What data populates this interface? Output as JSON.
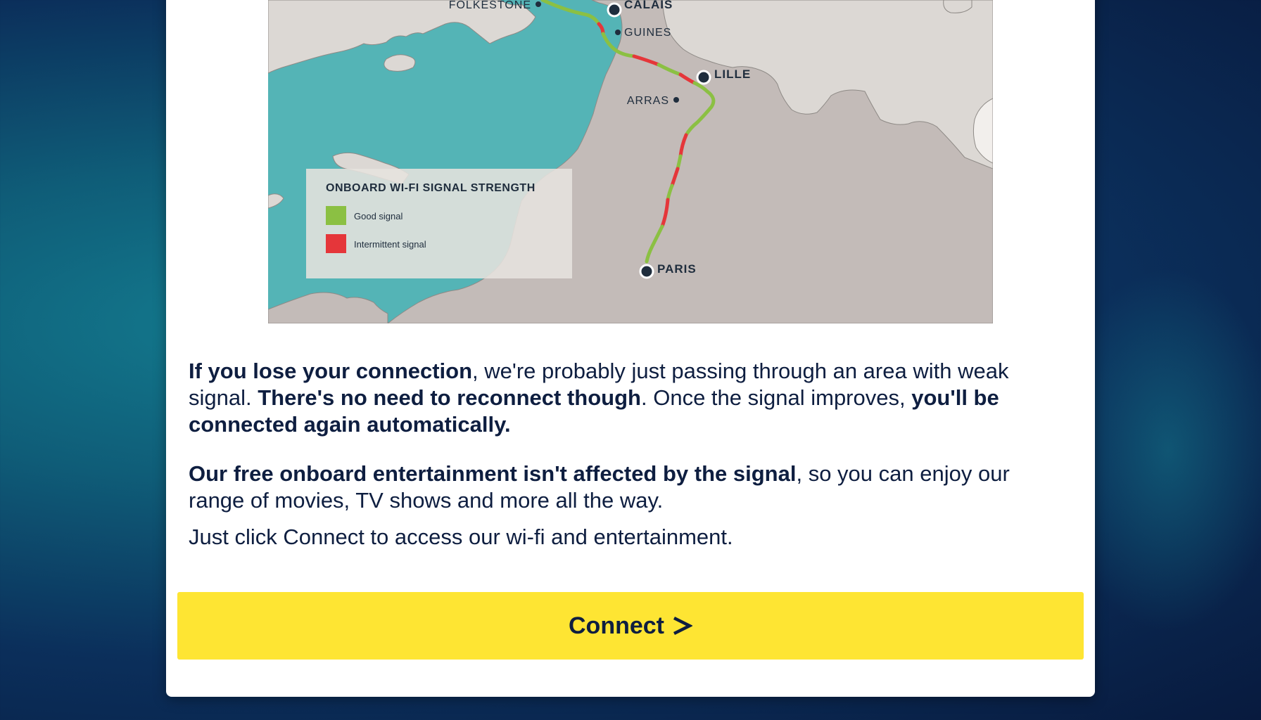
{
  "map": {
    "cities": {
      "folkestone": "FOLKESTONE",
      "calais": "CALAIS",
      "guines": "GUINES",
      "lille": "LILLE",
      "arras": "ARRAS",
      "paris": "PARIS"
    },
    "legend": {
      "title": "ONBOARD WI-FI SIGNAL STRENGTH",
      "good": "Good signal",
      "intermittent": "Intermittent signal"
    },
    "colors": {
      "sea": "#54b4b6",
      "land_uk": "#dcd8d4",
      "land_fr": "#c3bbb8",
      "good": "#8bc043",
      "intermittent": "#e5363a"
    }
  },
  "content": {
    "p1_b1": "If you lose your connection",
    "p1_t1": ", we're probably just passing through an area with weak signal. ",
    "p1_b2": "There's no need to reconnect though",
    "p1_t2": ". Once the signal improves, ",
    "p1_b3": "you'll be connected again automatically.",
    "p2_b1": "Our free onboard entertainment isn't affected by the signal",
    "p2_t1": ", so you can enjoy our range of movies, TV shows and more all the way.",
    "p3": "Just click Connect to access our wi-fi and entertainment."
  },
  "actions": {
    "connect_label": "Connect"
  },
  "theme": {
    "button_bg": "#fee533",
    "text": "#0e1e40"
  }
}
